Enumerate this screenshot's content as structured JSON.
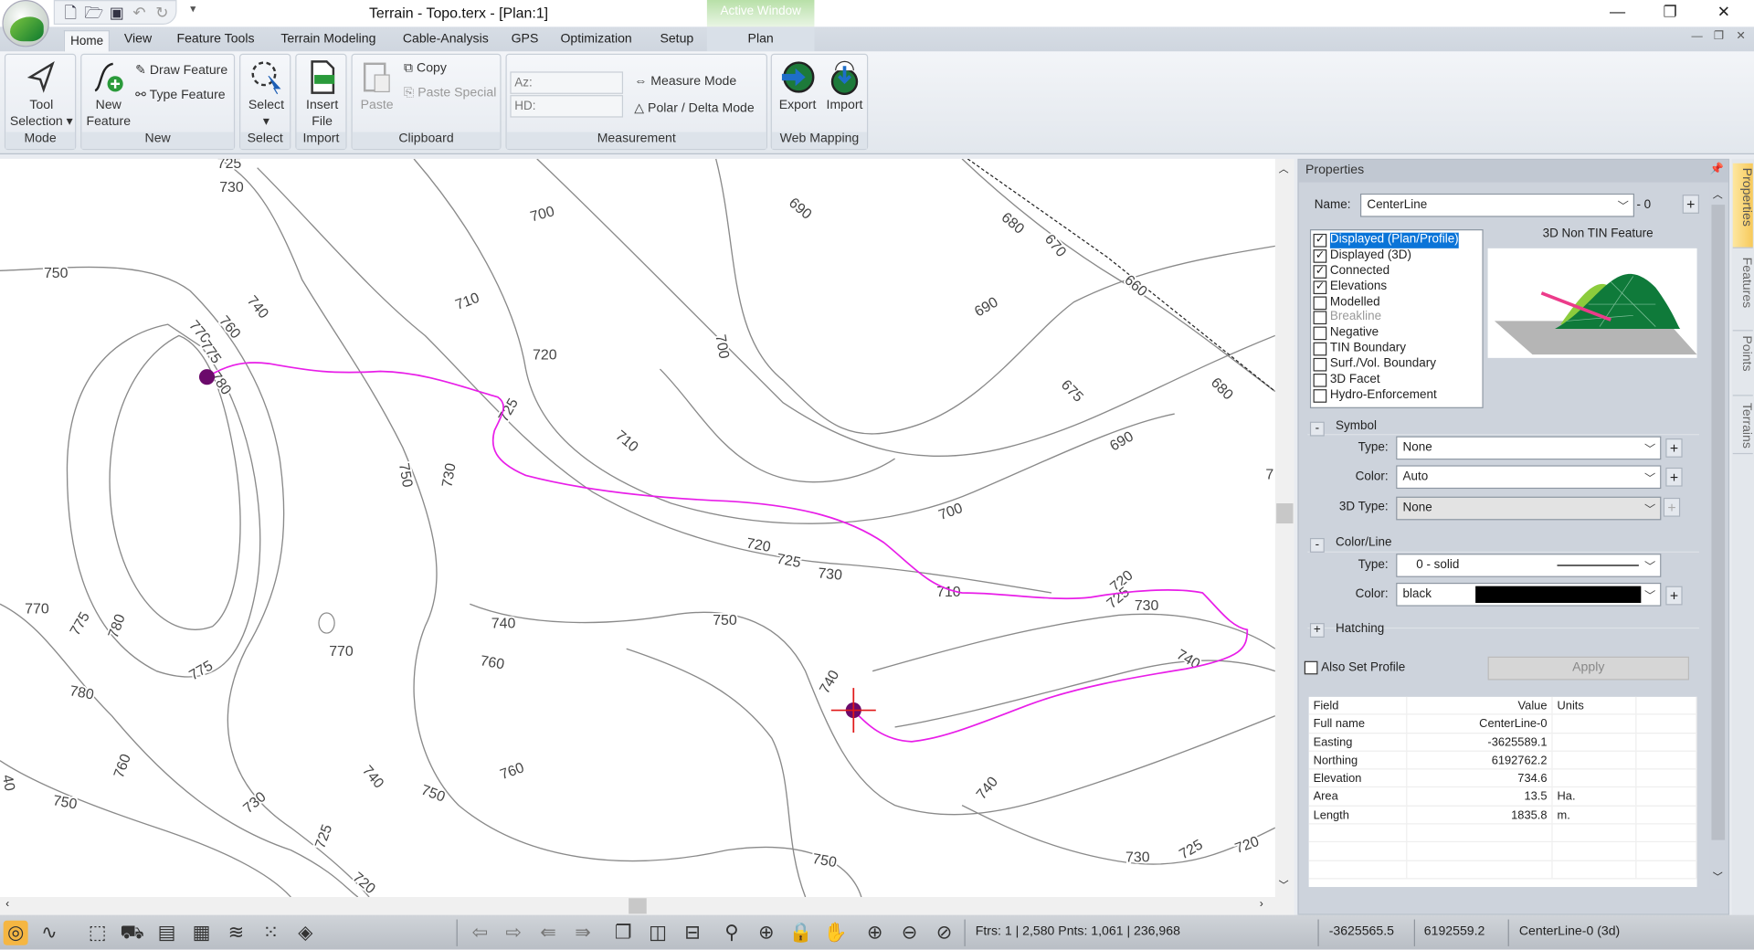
{
  "window": {
    "title": "Terrain - Topo.terx - [Plan:1]",
    "context_tab": "Active Window",
    "context_group": "Plan"
  },
  "tabs": [
    "Home",
    "View",
    "Feature Tools",
    "Terrain Modeling",
    "Cable-Analysis",
    "GPS",
    "Optimization",
    "Setup"
  ],
  "ribbon": {
    "mode": {
      "tool_selection": "Tool Selection",
      "group": "Mode"
    },
    "new": {
      "new_feature": "New Feature",
      "draw_feature": "Draw Feature",
      "type_feature": "Type Feature",
      "group": "New"
    },
    "select": {
      "select": "Select",
      "group": "Select"
    },
    "import": {
      "insert_file": "Insert File",
      "group": "Import"
    },
    "clipboard": {
      "paste": "Paste",
      "copy": "Copy",
      "paste_special": "Paste Special",
      "group": "Clipboard"
    },
    "measurement": {
      "az_placeholder": "Az:",
      "hd_placeholder": "HD:",
      "measure_mode": "Measure Mode",
      "polar_delta": "Polar / Delta Mode",
      "group": "Measurement"
    },
    "web_mapping": {
      "export": "Export",
      "import": "Import",
      "group": "Web Mapping"
    }
  },
  "map": {
    "contour_color": "#8a8a8a",
    "centerline_color": "#e81ee8",
    "point_color": "#6b0a6b",
    "contour_labels": [
      "725",
      "730",
      "700",
      "690",
      "680",
      "670",
      "660",
      "750",
      "740",
      "710",
      "760",
      "770",
      "775",
      "780",
      "720",
      "700",
      "690",
      "675",
      "680",
      "725",
      "710",
      "750",
      "730",
      "690",
      "700",
      "720",
      "725",
      "730",
      "710",
      "720",
      "725",
      "730",
      "740",
      "770",
      "775",
      "780",
      "740",
      "750",
      "770",
      "760",
      "775",
      "780",
      "740",
      "760",
      "740",
      "760",
      "750",
      "730",
      "740",
      "750",
      "725",
      "720",
      "750",
      "730",
      "725",
      "720",
      "40",
      "7"
    ]
  },
  "properties": {
    "title": "Properties",
    "name_label": "Name:",
    "name_value": "CenterLine",
    "name_suffix": "- 0",
    "flags": [
      {
        "label": "Displayed (Plan/Profile)",
        "checked": true,
        "highlighted": true
      },
      {
        "label": "Displayed (3D)",
        "checked": true
      },
      {
        "label": "Connected",
        "checked": true
      },
      {
        "label": "Elevations",
        "checked": true
      },
      {
        "label": "Modelled",
        "checked": false
      },
      {
        "label": "Breakline",
        "checked": false,
        "disabled": true
      },
      {
        "label": "Negative",
        "checked": false
      },
      {
        "label": "TIN Boundary",
        "checked": false
      },
      {
        "label": "Surf./Vol. Boundary",
        "checked": false
      },
      {
        "label": "3D Facet",
        "checked": false
      },
      {
        "label": "Hydro-Enforcement",
        "checked": false
      }
    ],
    "preview_title": "3D Non TIN Feature",
    "symbol": {
      "header": "Symbol",
      "type_label": "Type:",
      "type_value": "None",
      "color_label": "Color:",
      "color_value": "Auto",
      "type3d_label": "3D Type:",
      "type3d_value": "None"
    },
    "color_line": {
      "header": "Color/Line",
      "type_label": "Type:",
      "type_value": "0 - solid",
      "color_label": "Color:",
      "color_value": "black",
      "swatch": "#000000"
    },
    "hatching": {
      "header": "Hatching"
    },
    "also_set_profile": "Also Set Profile",
    "apply": "Apply",
    "table": {
      "headers": [
        "Field",
        "Value",
        "Units",
        ""
      ],
      "rows": [
        [
          "Full name",
          "CenterLine-0",
          ""
        ],
        [
          "Easting",
          "-3625589.1",
          ""
        ],
        [
          "Northing",
          "6192762.2",
          ""
        ],
        [
          "Elevation",
          "734.6",
          ""
        ],
        [
          "Area",
          "13.5",
          "Ha."
        ],
        [
          "Length",
          "1835.8",
          "m."
        ]
      ]
    }
  },
  "side_tabs": [
    "Properties",
    "Features",
    "Points",
    "Terrains"
  ],
  "status": {
    "counts": "Ftrs: 1 | 2,580  Pnts: 1,061 | 236,968",
    "easting": "-3625565.5",
    "northing": "6192559.2",
    "feature": "CenterLine-0 (3d)"
  }
}
